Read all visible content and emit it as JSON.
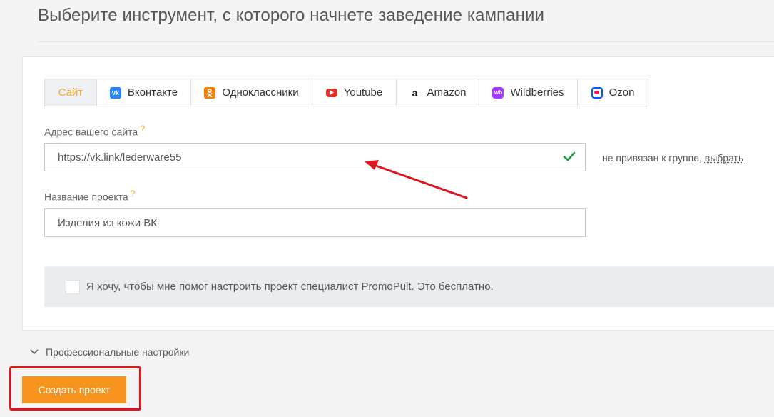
{
  "header": {
    "title": "Выберите инструмент, с которого начнете заведение кампании"
  },
  "tabs": [
    {
      "label": "Сайт",
      "icon": "",
      "active": true
    },
    {
      "label": "Вконтакте",
      "icon": "vk-icon"
    },
    {
      "label": "Одноклассники",
      "icon": "odnoklassniki-icon"
    },
    {
      "label": "Youtube",
      "icon": "youtube-icon"
    },
    {
      "label": "Amazon",
      "icon": "amazon-icon"
    },
    {
      "label": "Wildberries",
      "icon": "wildberries-icon"
    },
    {
      "label": "Ozon",
      "icon": "ozon-icon"
    }
  ],
  "site": {
    "label": "Адрес вашего сайта",
    "help_mark": "?",
    "value": "https://vk.link/lederware55",
    "status_text": "не привязан к группе,",
    "status_link": "выбрать"
  },
  "project": {
    "label": "Название проекта",
    "help_mark": "?",
    "value": "Изделия из кожи ВК"
  },
  "assist": {
    "text": "Я хочу, чтобы мне помог настроить проект специалист PromoPult. Это бесплатно."
  },
  "pro_settings": {
    "label": "Профессиональные настройки"
  },
  "actions": {
    "create_label": "Создать проект"
  },
  "colors": {
    "accent": "#f7941d",
    "active_tab_text": "#f5a623",
    "annotation": "#e0161e",
    "valid_check": "#1e9e3a"
  }
}
